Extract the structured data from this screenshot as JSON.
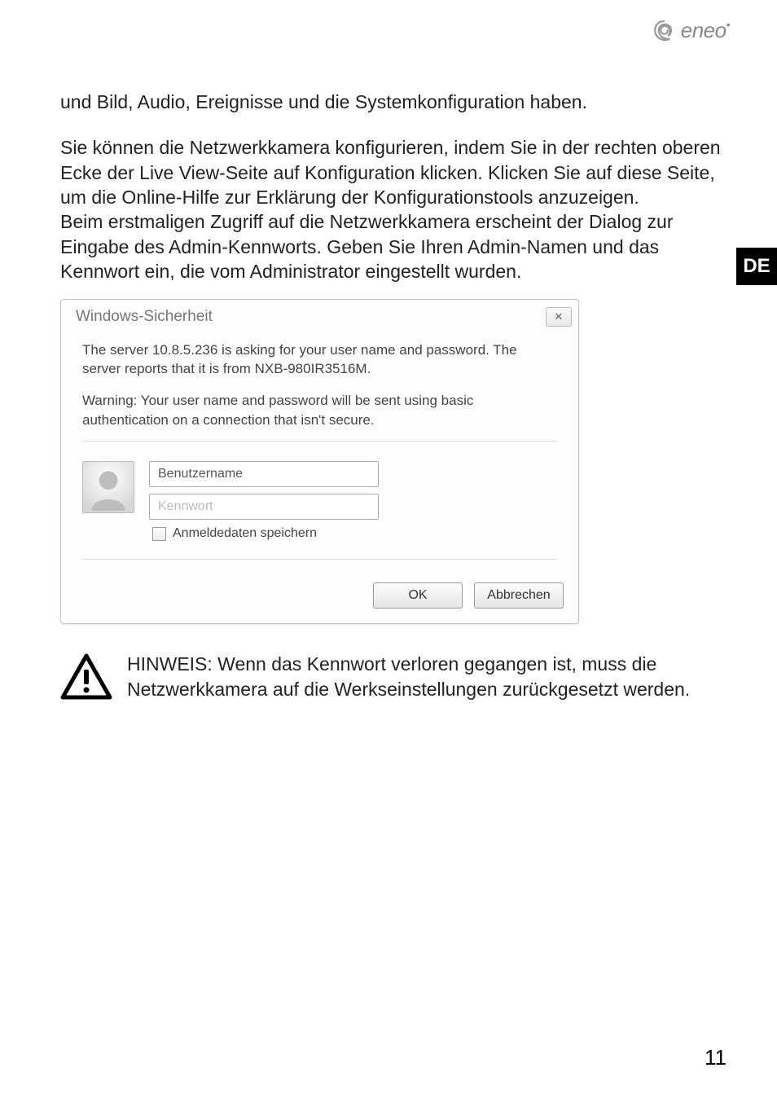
{
  "brand": {
    "name": "eneo"
  },
  "lang_tab": "DE",
  "paragraphs": {
    "p1": "und Bild, Audio, Ereignisse und die Systemkonfiguration haben.",
    "p2": "Sie können die Netzwerkkamera konfigurieren, indem Sie in der rechten oberen Ecke der Live View-Seite auf Konfiguration klicken. Klicken Sie auf diese Seite, um die Online-Hilfe zur Erklärung der Konfigurationstools anzu­zeigen.",
    "p3": "Beim erstmaligen Zugriff auf die Netzwerkkamera erscheint der Dialog zur Eingabe des Admin-Kennworts. Geben Sie Ihren Admin-Namen und das Kennwort ein, die vom Administrator eingestellt wurden."
  },
  "dialog": {
    "title": "Windows-Sicherheit",
    "close_glyph": "✕",
    "message1": "The server 10.8.5.236 is asking for your user name and password. The server reports that it is from NXB-980IR3516M.",
    "message2": "Warning: Your user name and password will be sent using basic authentication on a connection that isn't secure.",
    "username_placeholder": "Benutzername",
    "password_placeholder": "Kennwort",
    "remember_label": "Anmeldedaten speichern",
    "ok_label": "OK",
    "cancel_label": "Abbrechen"
  },
  "note": {
    "text": "HINWEIS: Wenn das Kennwort verloren gegangen ist, muss die Netzwerkkamera auf die Werkseinstellungen zurückgesetzt wer­den."
  },
  "page_number": "11"
}
